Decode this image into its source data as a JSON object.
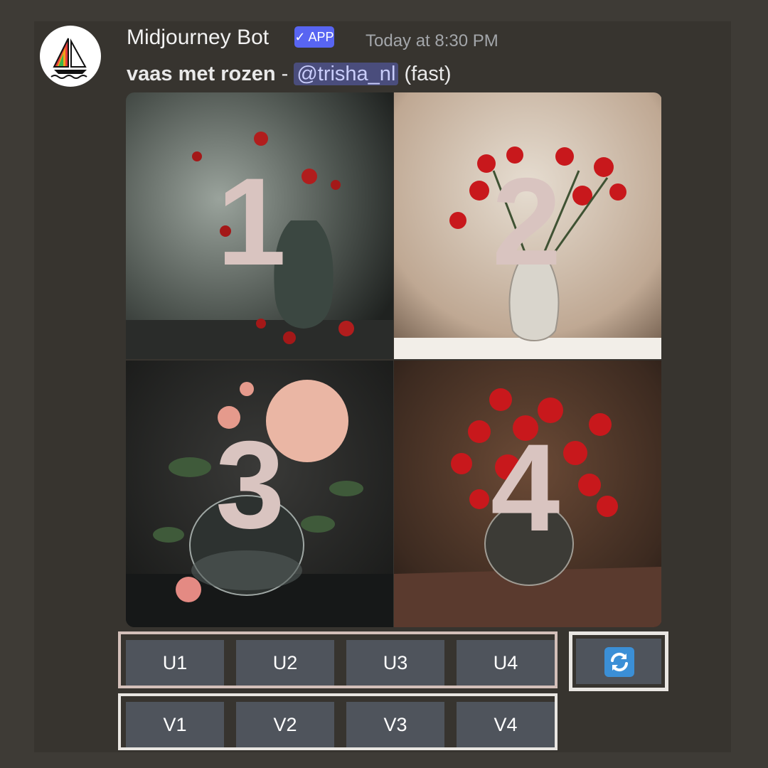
{
  "message": {
    "author": "Midjourney Bot",
    "badge": "APP",
    "timestamp": "Today at 8:30 PM",
    "prompt": "vaas met rozen",
    "separator": " - ",
    "mention": "@trisha_nl",
    "speed": " (fast)",
    "avatar_icon": "sailboat-icon"
  },
  "grid": {
    "tiles": [
      {
        "number": "1"
      },
      {
        "number": "2"
      },
      {
        "number": "3"
      },
      {
        "number": "4"
      }
    ]
  },
  "upscale_buttons": [
    "U1",
    "U2",
    "U3",
    "U4"
  ],
  "variation_buttons": [
    "V1",
    "V2",
    "V3",
    "V4"
  ],
  "reroll": {
    "icon": "reroll-icon"
  },
  "colors": {
    "background": "#3e3b36",
    "button": "#4f545c",
    "badge": "#5865f2",
    "mention_bg": "#4a4d7c",
    "reroll_icon": "#3b8fd6"
  }
}
